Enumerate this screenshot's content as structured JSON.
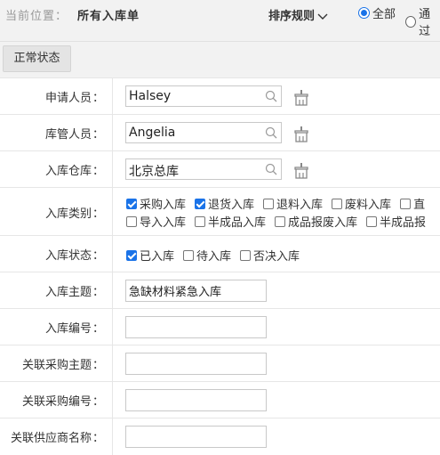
{
  "header": {
    "location_prefix": "当前位置：",
    "location_current": "所有入库单",
    "sort_label": "排序规则",
    "filters": [
      {
        "label": "全部",
        "checked": true
      },
      {
        "label": "通过",
        "checked": false
      }
    ]
  },
  "tabs": [
    {
      "label": "正常状态"
    }
  ],
  "form": {
    "applicant": {
      "label": "申请人员",
      "value": "Halsey"
    },
    "keeper": {
      "label": "库管人员",
      "value": "Angelia"
    },
    "warehouse": {
      "label": "入库仓库",
      "value": "北京总库"
    },
    "category": {
      "label": "入库类别",
      "options_row1": [
        {
          "label": "采购入库",
          "checked": true
        },
        {
          "label": "退货入库",
          "checked": true
        },
        {
          "label": "退料入库",
          "checked": false
        },
        {
          "label": "废料入库",
          "checked": false
        },
        {
          "label": "直",
          "checked": false
        }
      ],
      "options_row2": [
        {
          "label": "导入入库",
          "checked": false
        },
        {
          "label": "半成品入库",
          "checked": false
        },
        {
          "label": "成品报废入库",
          "checked": false
        },
        {
          "label": "半成品报",
          "checked": false
        }
      ]
    },
    "status": {
      "label": "入库状态",
      "options": [
        {
          "label": "已入库",
          "checked": true
        },
        {
          "label": "待入库",
          "checked": false
        },
        {
          "label": "否决入库",
          "checked": false
        }
      ]
    },
    "subject": {
      "label": "入库主题",
      "value": "急缺材料紧急入库"
    },
    "number": {
      "label": "入库编号",
      "value": ""
    },
    "purchase_subject": {
      "label": "关联采购主题",
      "value": ""
    },
    "purchase_number": {
      "label": "关联采购编号",
      "value": ""
    },
    "supplier_name": {
      "label": "关联供应商名称",
      "value": ""
    },
    "colon": "："
  },
  "colors": {
    "accent": "#1a73e8",
    "header_bg": "#f2f2f2",
    "border": "#e6e6e6"
  }
}
